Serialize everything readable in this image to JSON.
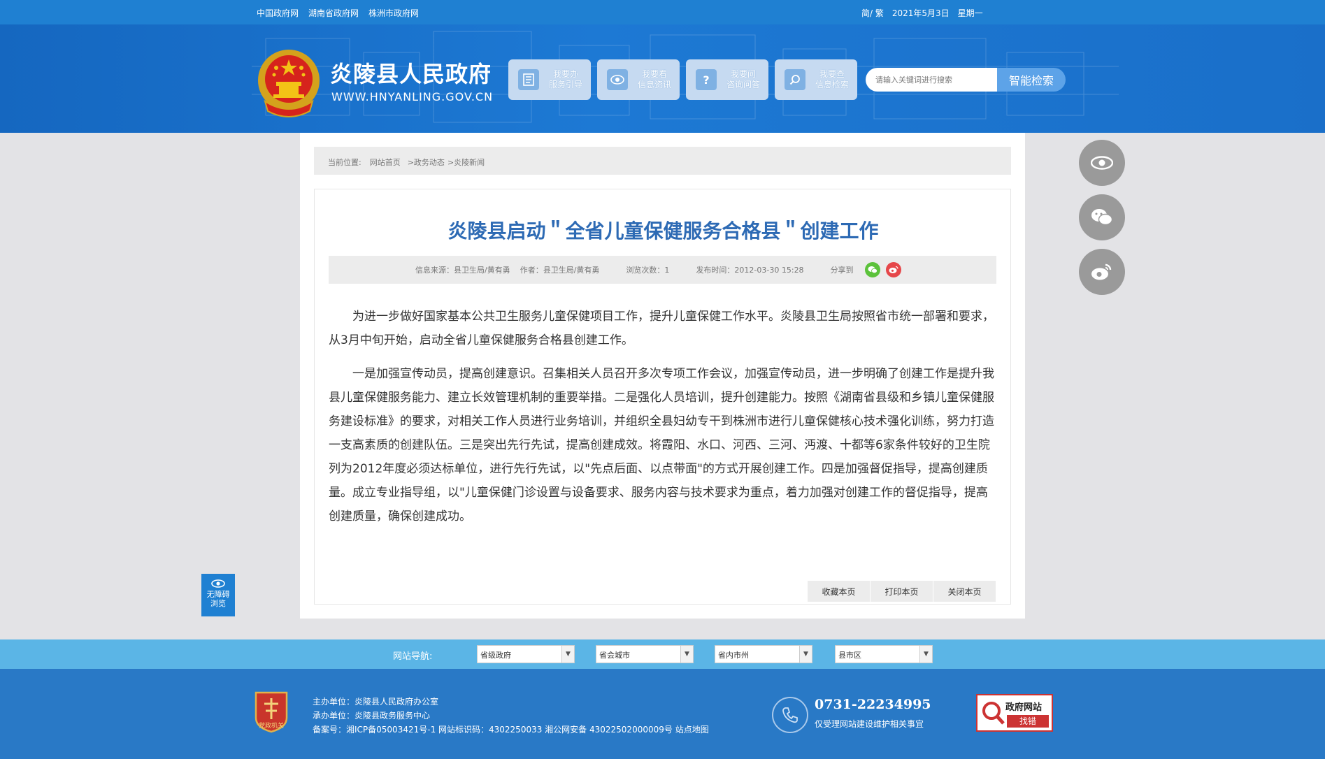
{
  "topbar": {
    "links": [
      "中国政府网",
      "湖南省政府网",
      "株洲市政府网"
    ],
    "lang": "简/ 繁",
    "date": "2021年5月3日",
    "weekday": "星期一"
  },
  "header": {
    "site_title": "炎陵县人民政府",
    "site_url": "WWW.HNYANLING.GOV.CN",
    "quick_links": [
      {
        "line1": "我要办",
        "line2": "服务引导",
        "icon": "document-icon"
      },
      {
        "line1": "我要看",
        "line2": "信息资讯",
        "icon": "eye-icon"
      },
      {
        "line1": "我要问",
        "line2": "咨询问答",
        "icon": "question-icon"
      },
      {
        "line1": "我要查",
        "line2": "信息检索",
        "icon": "search-icon"
      }
    ],
    "search_placeholder": "请输入关键词进行搜索",
    "search_button": "智能检索"
  },
  "breadcrumb": {
    "prefix": "当前位置:",
    "items": [
      "网站首页",
      ">政务动态",
      ">炎陵新闻"
    ]
  },
  "article": {
    "title": "炎陵县启动＂全省儿童保健服务合格县＂创建工作",
    "source": "信息来源：县卫生局/黄有勇",
    "author": "作者：县卫生局/黄有勇",
    "views": "浏览次数：1",
    "published": "发布时间：2012-03-30 15:28",
    "share_label": "分享到",
    "paragraphs": [
      "为进一步做好国家基本公共卫生服务儿童保健项目工作，提升儿童保健工作水平。炎陵县卫生局按照省市统一部署和要求，从3月中旬开始，启动全省儿童保健服务合格县创建工作。",
      "一是加强宣传动员，提高创建意识。召集相关人员召开多次专项工作会议，加强宣传动员，进一步明确了创建工作是提升我县儿童保健服务能力、建立长效管理机制的重要举措。二是强化人员培训，提升创建能力。按照《湖南省县级和乡镇儿童保健服务建设标准》的要求，对相关工作人员进行业务培训，并组织全县妇幼专干到株洲市进行儿童保健核心技术强化训练，努力打造一支高素质的创建队伍。三是突出先行先试，提高创建成效。将霞阳、水口、河西、三河、沔渡、十都等6家条件较好的卫生院列为2012年度必须达标单位，进行先行先试，以\"先点后面、以点带面\"的方式开展创建工作。四是加强督促指导，提高创建质量。成立专业指导组，以\"儿童保健门诊设置与设备要求、服务内容与技术要求为重点，着力加强对创建工作的督促指导，提高创建质量，确保创建成功。"
    ],
    "actions": [
      "收藏本页",
      "打印本页",
      "关闭本页"
    ]
  },
  "accessibility": {
    "line1": "无障碍",
    "line2": "浏览"
  },
  "site_nav": {
    "label": "网站导航:",
    "selects": [
      "省级政府",
      "省会城市",
      "省内市州",
      "县市区"
    ]
  },
  "footer": {
    "host": "主办单位：炎陵县人民政府办公室",
    "organizer": "承办单位：炎陵县政务服务中心",
    "record": "备案号：湘ICP备05003421号-1 网站标识码：4302250033 湘公网安备 43022502000009号 站点地图",
    "badge_text": "党政机关",
    "phone": "0731-22234995",
    "phone_note": "仅受理网站建设维护相关事宜",
    "error_title": "政府网站",
    "error_sub": "找错"
  },
  "colors": {
    "primary": "#1f80d2",
    "title_blue": "#2d6ab4",
    "nav_light": "#5bb5e6",
    "footer": "#2979c6"
  }
}
